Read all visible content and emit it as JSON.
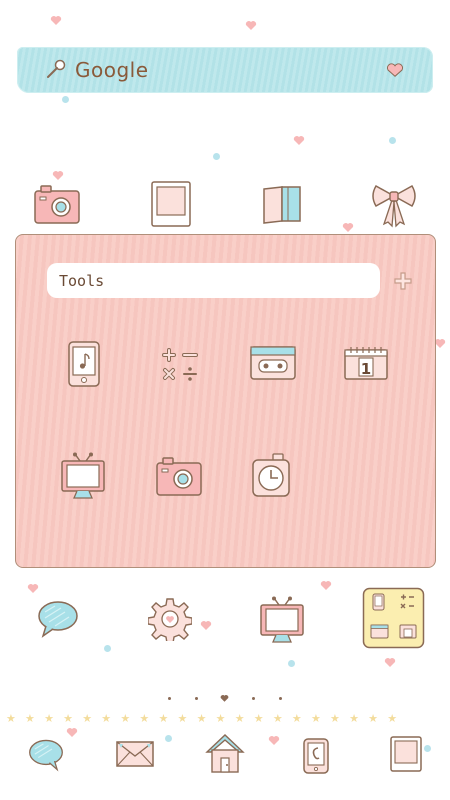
{
  "search": {
    "label": "Google"
  },
  "folder": {
    "name": "Tools"
  },
  "colors": {
    "search_bg": "#bfe8ec",
    "folder_bg": "#f9cfc8",
    "outline": "#8a6a55",
    "pink": "#f7b7b7",
    "blue": "#a8e0e8",
    "yellow": "#fbeeb0"
  },
  "top_icons": [
    "camera-icon",
    "photo-frame-icon",
    "book-icon",
    "bow-icon"
  ],
  "folder_apps": [
    "music-phone-icon",
    "calculator-icon",
    "cassette-icon",
    "calendar-icon",
    "tv-icon",
    "camera-icon",
    "clock-icon"
  ],
  "home_icons": [
    "chat-bubble-icon",
    "settings-gear-icon",
    "tv-icon",
    "tools-folder-icon"
  ],
  "page_indicator": {
    "pages": 5,
    "current": 3
  },
  "dock_icons": [
    "message-bubble-icon",
    "mail-icon",
    "home-icon",
    "phone-icon",
    "gallery-icon"
  ],
  "calendar_day": "1"
}
